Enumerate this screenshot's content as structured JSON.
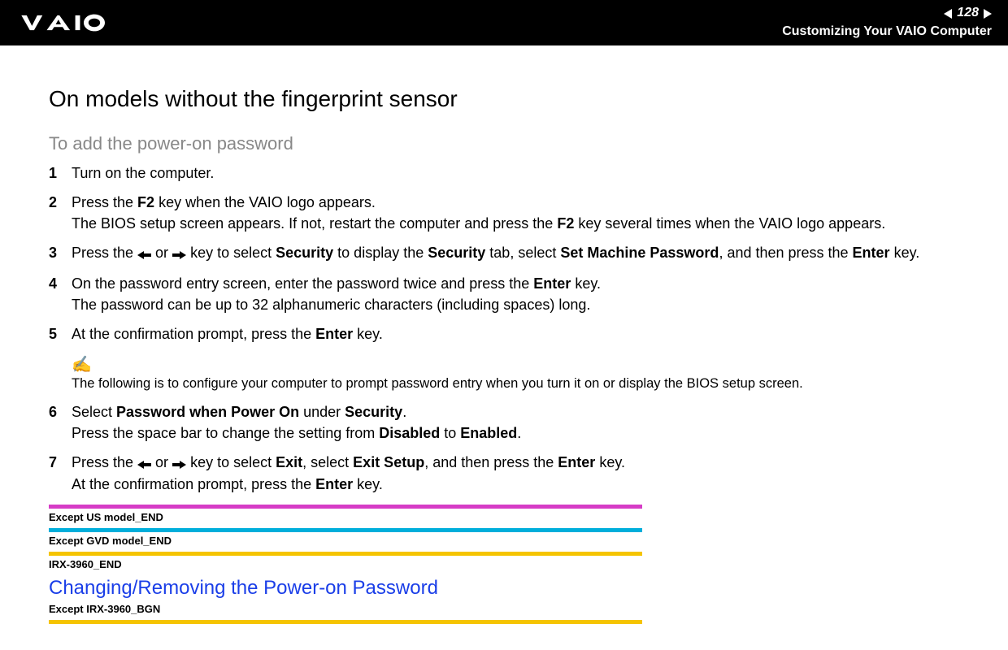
{
  "header": {
    "page_number": "128",
    "breadcrumb": "Customizing Your VAIO Computer"
  },
  "section_heading": "On models without the fingerprint sensor",
  "subheading": "To add the power-on password",
  "steps": {
    "s1": "Turn on the computer.",
    "s2a": "Press the ",
    "s2_f2": "F2",
    "s2b": " key when the VAIO logo appears.",
    "s2c": "The BIOS setup screen appears. If not, restart the computer and press the ",
    "s2d": " key several times when the VAIO logo appears.",
    "s3a": "Press the ",
    "s3_or": " or ",
    "s3b": " key to select ",
    "s3_security": "Security",
    "s3c": " to display the ",
    "s3d": " tab, select ",
    "s3_smp": "Set Machine Password",
    "s3e": ", and then press the ",
    "s3_enter": "Enter",
    "s3f": " key.",
    "s4a": "On the password entry screen, enter the password twice and press the ",
    "s4_enter": "Enter",
    "s4b": " key.",
    "s4c": "The password can be up to 32 alphanumeric characters (including spaces) long.",
    "s5a": "At the confirmation prompt, press the ",
    "s5_enter": "Enter",
    "s5b": " key.",
    "s6a": "Select ",
    "s6_pwpo": "Password when Power On",
    "s6b": " under ",
    "s6_security": "Security",
    "s6c": ".",
    "s6d": "Press the space bar to change the setting from ",
    "s6_disabled": "Disabled",
    "s6e": " to ",
    "s6_enabled": "Enabled",
    "s6f": ".",
    "s7a": "Press the ",
    "s7_or": " or ",
    "s7b": " key to select ",
    "s7_exit": "Exit",
    "s7c": ", select ",
    "s7_exitsetup": "Exit Setup",
    "s7d": ", and then press the ",
    "s7_enter": "Enter",
    "s7e": " key.",
    "s7f": "At the confirmation prompt, press the ",
    "s7g": " key."
  },
  "note": {
    "icon": "✍",
    "text": "The following is to configure your computer to prompt password entry when you turn it on or display the BIOS setup screen."
  },
  "markers": {
    "m1": "Except US model_END",
    "m2": "Except GVD model_END",
    "m3": "IRX-3960_END",
    "m4": "Except IRX-3960_BGN"
  },
  "changing_heading": "Changing/Removing the Power-on Password"
}
